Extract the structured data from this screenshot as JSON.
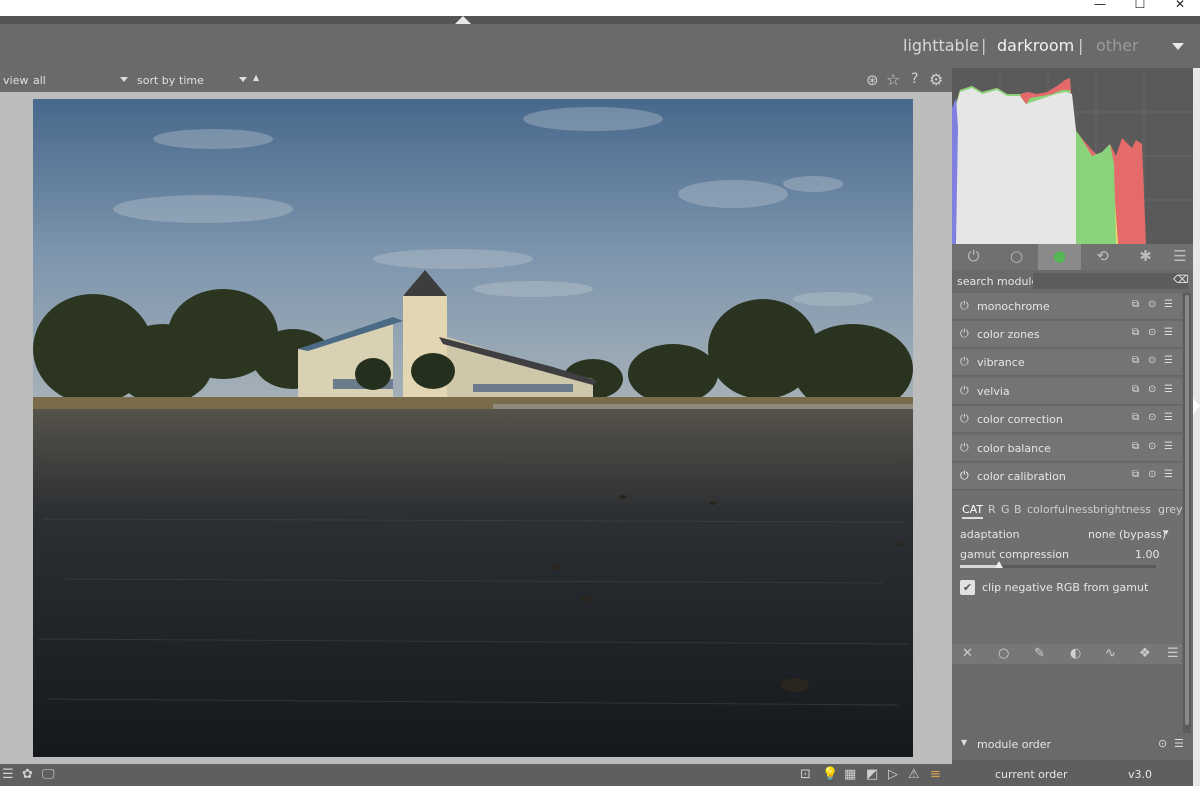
{
  "window": {
    "minimize_icon": "minimize-icon",
    "maximize_icon": "maximize-icon",
    "close_icon": "close-icon",
    "minimize_glyph": "—",
    "maximize_glyph": "☐",
    "close_glyph": "✕"
  },
  "views": {
    "lighttable": "lighttable",
    "darkroom": "darkroom",
    "other": "other",
    "sep": "|",
    "active": "darkroom"
  },
  "filterbar": {
    "view_label": "view",
    "view_value": "all",
    "sort_label": "sort by",
    "sort_value": "time",
    "sort_dir_glyph": "▲",
    "icons": [
      "color-palette-icon",
      "star-icon",
      "help-icon",
      "gear-icon"
    ],
    "icon_glyphs": [
      "⊛",
      "☆",
      "?",
      "⚙"
    ]
  },
  "module_tabs": {
    "icons": [
      "power-icon",
      "circle-icon",
      "color-wheel-icon",
      "refresh-icon",
      "aperture-icon",
      "menu-icon"
    ],
    "glyphs": [
      "⏻",
      "○",
      "●",
      "⟲",
      "✱",
      "☰"
    ]
  },
  "search": {
    "label": "search module",
    "clear_glyph": "⌫"
  },
  "modules": [
    {
      "name": "monochrome",
      "enabled": false
    },
    {
      "name": "color zones",
      "enabled": false
    },
    {
      "name": "vibrance",
      "enabled": false
    },
    {
      "name": "velvia",
      "enabled": false
    },
    {
      "name": "color correction",
      "enabled": false
    },
    {
      "name": "color balance",
      "enabled": false
    },
    {
      "name": "color calibration",
      "enabled": true
    }
  ],
  "module_icons": {
    "copy": "⧉",
    "reset": "⊙",
    "presets": "☰",
    "power": "⏻"
  },
  "color_calibration": {
    "tabs": [
      "CAT",
      "R",
      "G",
      "B",
      "colorfulness",
      "brightness",
      "grey"
    ],
    "active_tab": "CAT",
    "adaptation_label": "adaptation",
    "adaptation_value": "none (bypass)",
    "gamut_label": "gamut compression",
    "gamut_value": "1.00",
    "gamut_fraction": 0.2,
    "clip_label": "clip negative RGB from gamut",
    "clip_checked": true,
    "check_glyph": "✔",
    "dd_glyph": "▾"
  },
  "bottom_tools": {
    "icons": [
      "close-icon",
      "circle-icon",
      "brush-icon",
      "gradient-icon",
      "path-icon",
      "shapes-icon",
      "menu-icon"
    ],
    "glyphs": [
      "✕",
      "○",
      "✎",
      "◐",
      "∿",
      "❖",
      "☰"
    ]
  },
  "module_order": {
    "label": "module order",
    "current_label": "current order",
    "version": "v3.0"
  },
  "statusbar": {
    "left_icons": [
      "menu-icon",
      "style-icon",
      "display-icon"
    ],
    "left_glyphs": [
      "☰",
      "✿",
      "🖵"
    ],
    "right_icons": [
      "iso-icon",
      "bulb-icon",
      "color-assessment-icon",
      "softproof-icon",
      "gamut-check-icon",
      "warning-icon",
      "guides-icon"
    ],
    "right_glyphs": [
      "⊡",
      "💡",
      "▦",
      "◩",
      "▷",
      "⚠",
      "≡"
    ]
  }
}
